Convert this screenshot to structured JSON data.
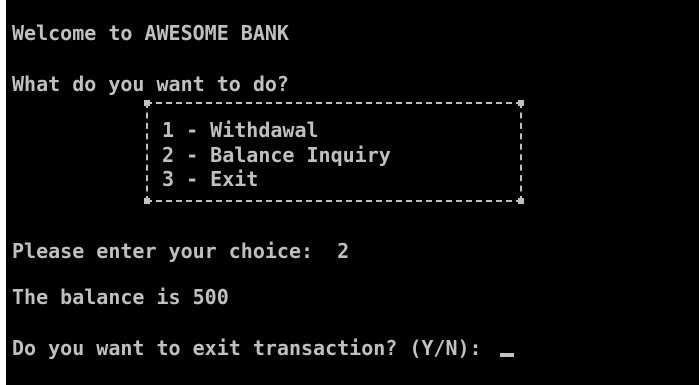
{
  "console": {
    "welcome": "Welcome to AWESOME BANK",
    "question": "What do you want to do?",
    "menu": [
      "1 - Withdawal",
      "2 - Balance Inquiry",
      "3 - Exit"
    ],
    "choice_prompt": "Please enter your choice:  2",
    "balance_message": "The balance is 500",
    "exit_prompt": "Do you want to exit transaction? (Y/N): "
  },
  "colors": {
    "background": "#000000",
    "text": "#c0c0c0",
    "border": "#ffffff"
  }
}
